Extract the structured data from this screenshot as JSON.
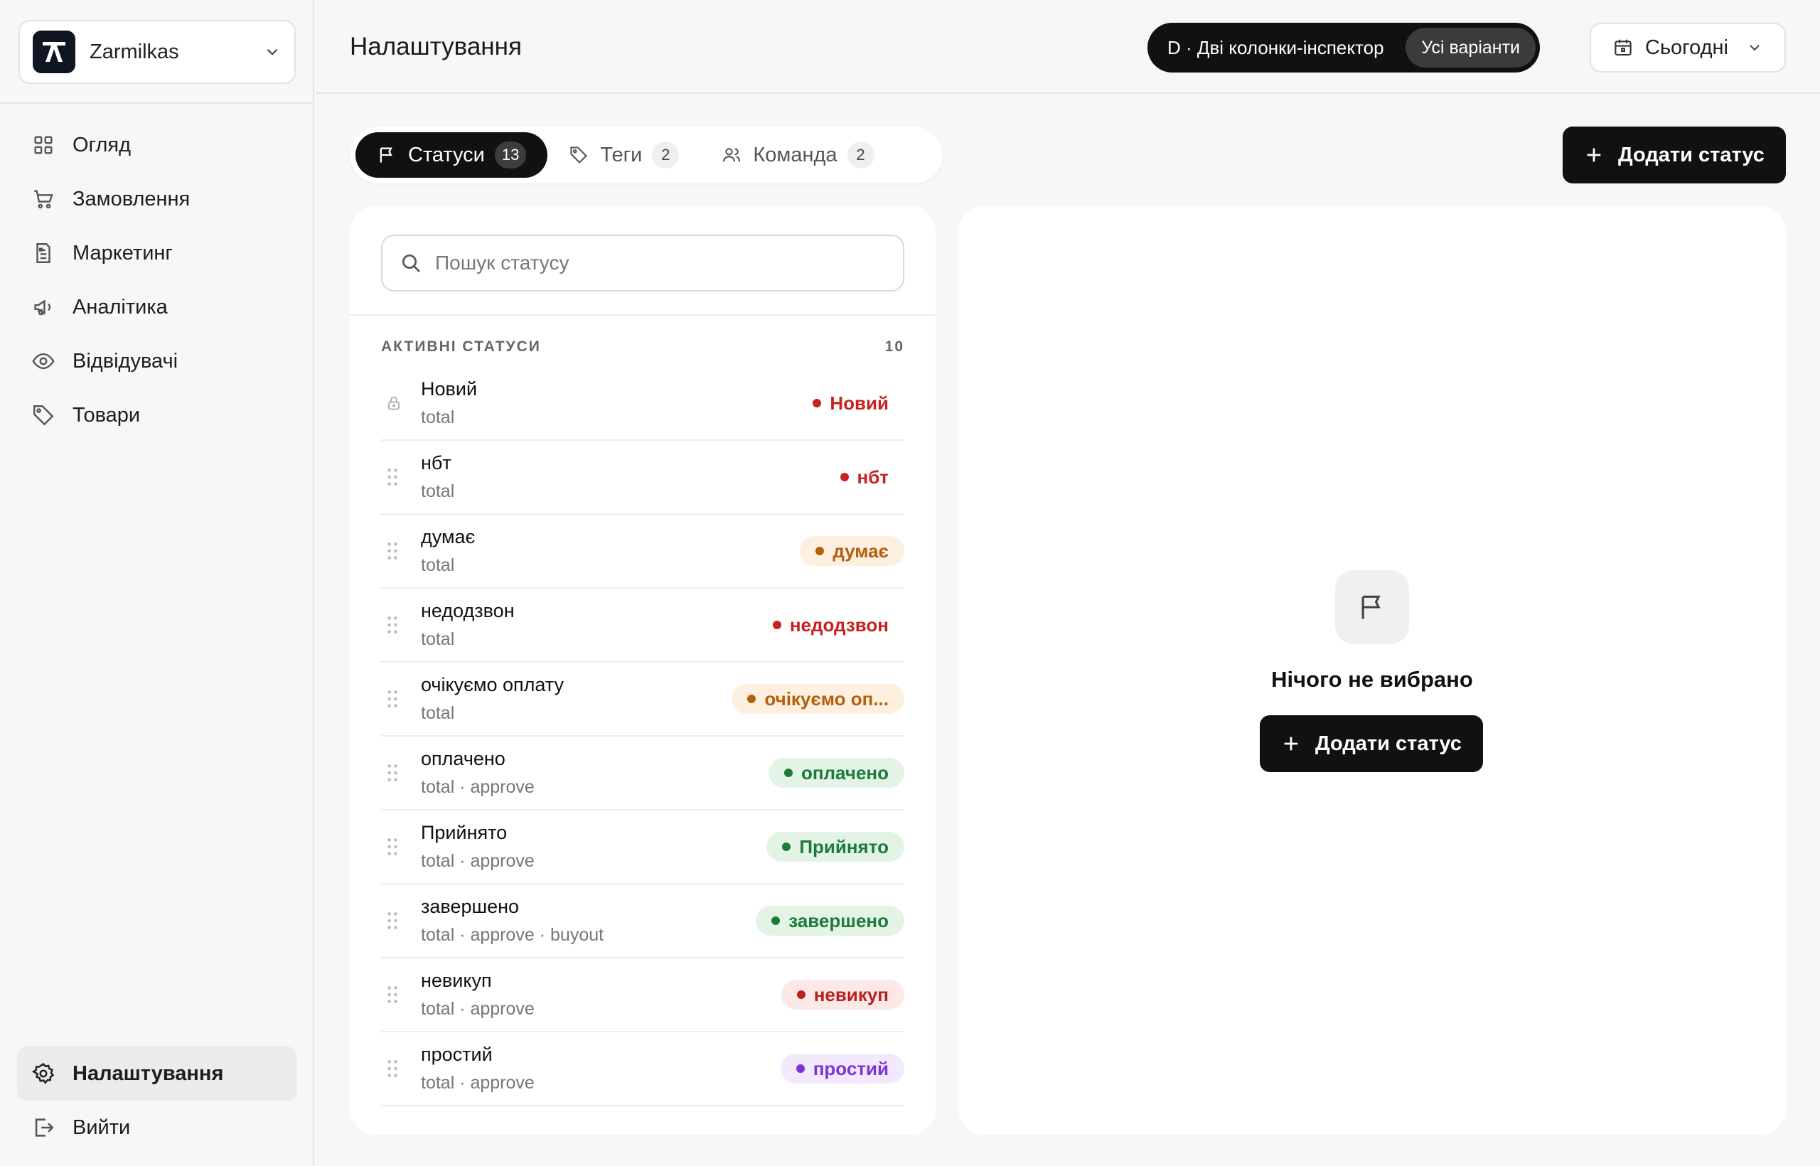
{
  "workspace": {
    "name": "Zarmilkas"
  },
  "sidebar": {
    "items": [
      {
        "label": "Огляд",
        "icon": "grid-icon"
      },
      {
        "label": "Замовлення",
        "icon": "cart-icon"
      },
      {
        "label": "Маркетинг",
        "icon": "document-icon"
      },
      {
        "label": "Аналітика",
        "icon": "megaphone-icon"
      },
      {
        "label": "Відвідувачі",
        "icon": "eye-icon"
      },
      {
        "label": "Товари",
        "icon": "tag-icon"
      }
    ],
    "settings_label": "Налаштування",
    "logout_label": "Вийти"
  },
  "header": {
    "title": "Налаштування",
    "variant_label": "D · Дві колонки-інспектор",
    "variant_button": "Усі варіанти",
    "date_label": "Сьогодні"
  },
  "tabs": [
    {
      "label": "Статуси",
      "count": "13",
      "active": true
    },
    {
      "label": "Теги",
      "count": "2",
      "active": false
    },
    {
      "label": "Команда",
      "count": "2",
      "active": false
    }
  ],
  "add_status_label": "Додати статус",
  "search": {
    "placeholder": "Пошук статусу",
    "value": ""
  },
  "section": {
    "title": "АКТИВНІ СТАТУСИ",
    "count": "10"
  },
  "statuses": [
    {
      "name": "Новий",
      "sub": "total",
      "badge": "Новий",
      "tone": "red",
      "locked": true
    },
    {
      "name": "нбт",
      "sub": "total",
      "badge": "нбт",
      "tone": "red",
      "locked": false
    },
    {
      "name": "думає",
      "sub": "total",
      "badge": "думає",
      "tone": "orange",
      "locked": false
    },
    {
      "name": "недодзвон",
      "sub": "total",
      "badge": "недодзвон",
      "tone": "red",
      "locked": false
    },
    {
      "name": "очікуємо оплату",
      "sub": "total",
      "badge": "очікуємо оп...",
      "tone": "orange",
      "locked": false
    },
    {
      "name": "оплачено",
      "sub": "total · approve",
      "badge": "оплачено",
      "tone": "green",
      "locked": false
    },
    {
      "name": "Прийнято",
      "sub": "total · approve",
      "badge": "Прийнято",
      "tone": "green",
      "locked": false
    },
    {
      "name": "завершено",
      "sub": "total · approve · buyout",
      "badge": "завершено",
      "tone": "green",
      "locked": false
    },
    {
      "name": "невикуп",
      "sub": "total · approve",
      "badge": "невикуп",
      "tone": "redbg",
      "locked": false
    },
    {
      "name": "простий",
      "sub": "total · approve",
      "badge": "простий",
      "tone": "purple",
      "locked": false
    }
  ],
  "detail": {
    "empty_title": "Нічого не вибрано",
    "empty_icon": "flag-icon"
  },
  "colors": {
    "accent": "#111111",
    "red": "#c7221f",
    "orange": "#b4600b",
    "green": "#1d7a3c",
    "purple": "#7b34d6"
  }
}
